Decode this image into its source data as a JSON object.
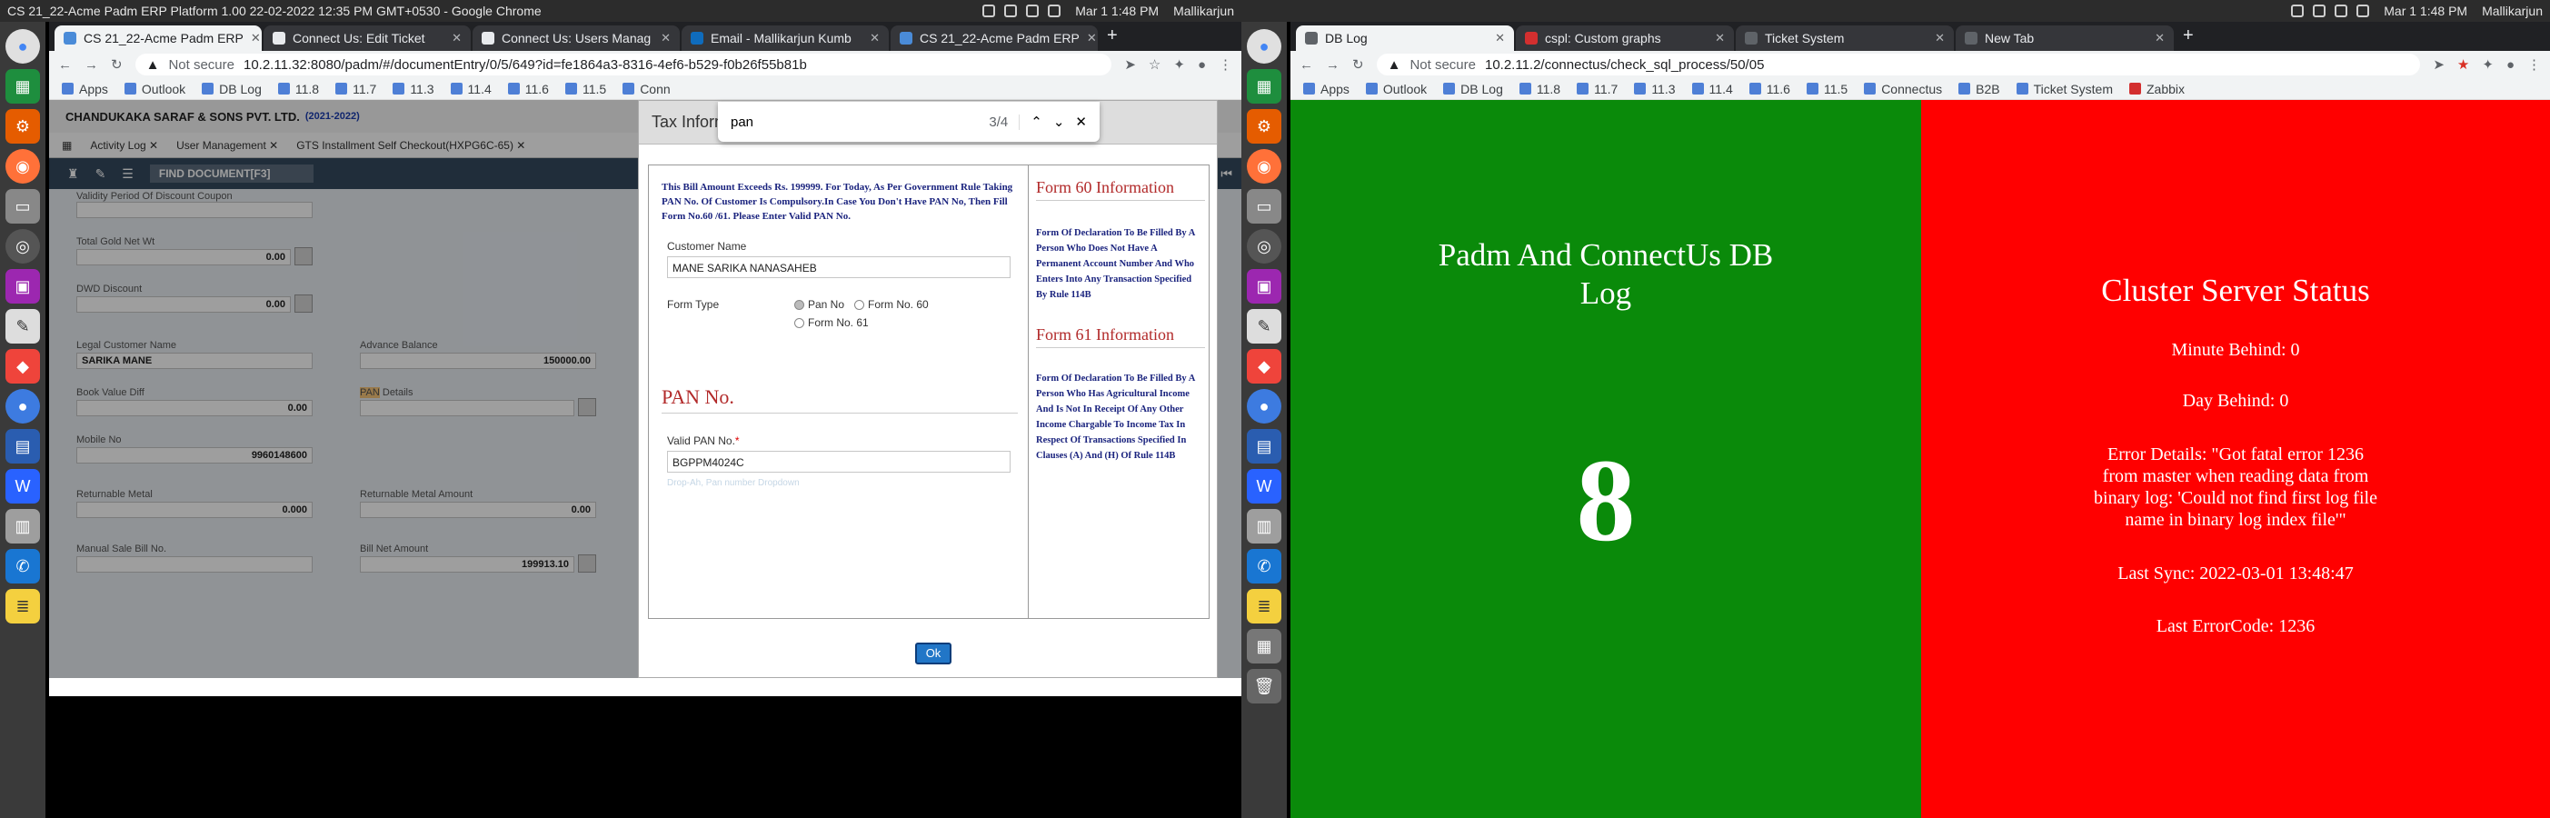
{
  "left": {
    "topbar": {
      "title": "CS 21_22-Acme Padm ERP Platform 1.00 22-02-2022 12:35 PM GMT+0530 - Google Chrome",
      "date": "Mar 1 1:48 PM",
      "user": "Mallikarjun"
    },
    "tabs": [
      {
        "label": "CS 21_22-Acme Padm ERP",
        "color": "#4a8bd8"
      },
      {
        "label": "Connect Us: Edit Ticket",
        "color": "#e8eaed"
      },
      {
        "label": "Connect Us: Users Manag",
        "color": "#e8eaed"
      },
      {
        "label": "Email - Mallikarjun Kumb",
        "color": "#0f6cbd"
      },
      {
        "label": "CS 21_22-Acme Padm ERP",
        "color": "#4a8bd8"
      }
    ],
    "omnibox": {
      "not_secure": "Not secure",
      "url": "10.2.11.32:8080/padm/#/documentEntry/0/5/649?id=fe1864a3-8316-4ef6-b529-f0b26f55b81b"
    },
    "find": {
      "query": "pan",
      "count": "3/4"
    },
    "bookmarks": [
      "Apps",
      "Outlook",
      "DB Log",
      "11.8",
      "11.7",
      "11.3",
      "11.4",
      "11.6",
      "11.5",
      "Conn"
    ],
    "erp": {
      "company": "CHANDUKAKA SARAF & SONS PVT. LTD.",
      "year": "(2021-2022)",
      "tabs": [
        "Activity Log",
        "User Management",
        "GTS Installment Self Checkout(HXPG6C-65)"
      ],
      "find_document": "FIND DOCUMENT[F3]",
      "fields": {
        "validity_label": "Validity Period Of Discount Coupon",
        "total_gold_label": "Total Gold Net Wt",
        "total_gold": "0.00",
        "dwd_label": "DWD Discount",
        "dwd": "0.00",
        "legal_name_label": "Legal Customer Name",
        "legal_name": "SARIKA MANE",
        "advance_label": "Advance Balance",
        "advance": "150000.00",
        "book_value_label": "Book Value Diff",
        "book_value": "0.00",
        "pan_hl": "PAN",
        "pan_details_label": "Details",
        "mobile_label": "Mobile No",
        "mobile": "9960148600",
        "returnable_label": "Returnable Metal",
        "returnable": "0.000",
        "returnable_amt_label": "Returnable Metal Amount",
        "returnable_amt": "0.00",
        "manual_bill_label": "Manual Sale Bill No.",
        "bill_net_label": "Bill Net Amount",
        "bill_net": "199913.10"
      }
    },
    "modal": {
      "title": "Tax Information Form",
      "notice": "This Bill Amount Exceeds Rs. 199999. For Today, As Per Government Rule Taking PAN No. Of Customer Is Compulsory.In Case You Don't Have PAN No, Then Fill Form No.60 /61. Please Enter Valid PAN No.",
      "customer_name_label": "Customer Name",
      "customer_name": "MANE SARIKA NANASAHEB",
      "form_type_label": "Form Type",
      "options": [
        "Pan No",
        "Form No. 60",
        "Form No. 61"
      ],
      "pan_heading": "PAN No.",
      "valid_pan_label": "Valid PAN No.",
      "required": "*",
      "pan_value": "BGPPM4024C",
      "faint_link": "Drop-Ah, Pan number Dropdown",
      "form60_title": "Form 60 Information",
      "form60_text": "Form Of Declaration To Be Filled By A Person Who Does Not Have A Permanent Account Number And Who Enters Into Any Transaction Specified By Rule 114B",
      "form61_title": "Form 61 Information",
      "form61_text": "Form Of Declaration To Be Filled By A Person Who Has Agricultural Income And Is Not In Receipt Of Any Other Income Chargable To Income Tax In Respect Of Transactions Specified In Clauses (A) And (H) Of Rule 114B",
      "ok": "Ok"
    }
  },
  "right": {
    "topbar": {
      "date": "Mar 1 1:48 PM",
      "user": "Mallikarjun"
    },
    "tabs": [
      {
        "label": "DB Log",
        "color": "#5f6368"
      },
      {
        "label": "cspl: Custom graphs",
        "color": "#d32f2f"
      },
      {
        "label": "Ticket System",
        "color": "#5f6368"
      },
      {
        "label": "New Tab",
        "color": "#5f6368"
      }
    ],
    "omnibox": {
      "not_secure": "Not secure",
      "url": "10.2.11.2/connectus/check_sql_process/50/05"
    },
    "bookmarks": [
      "Apps",
      "Outlook",
      "DB Log",
      "11.8",
      "11.7",
      "11.3",
      "11.4",
      "11.6",
      "11.5",
      "Connectus",
      "B2B",
      "Ticket System",
      "Zabbix"
    ],
    "left_panel": {
      "title": "Padm And ConnectUs DB Log",
      "count": "8",
      "color": "#0a8a0a"
    },
    "right_panel": {
      "title": "Cluster Server Status",
      "minute": "Minute Behind: 0",
      "day": "Day Behind: 0",
      "error": "Error Details: \"Got fatal error 1236 from master when reading data from binary log: 'Could not find first log file name in binary log index file'\"",
      "last_sync": "Last Sync: 2022-03-01 13:48:47",
      "last_error": "Last ErrorCode: 1236",
      "color": "#ff0000"
    }
  }
}
